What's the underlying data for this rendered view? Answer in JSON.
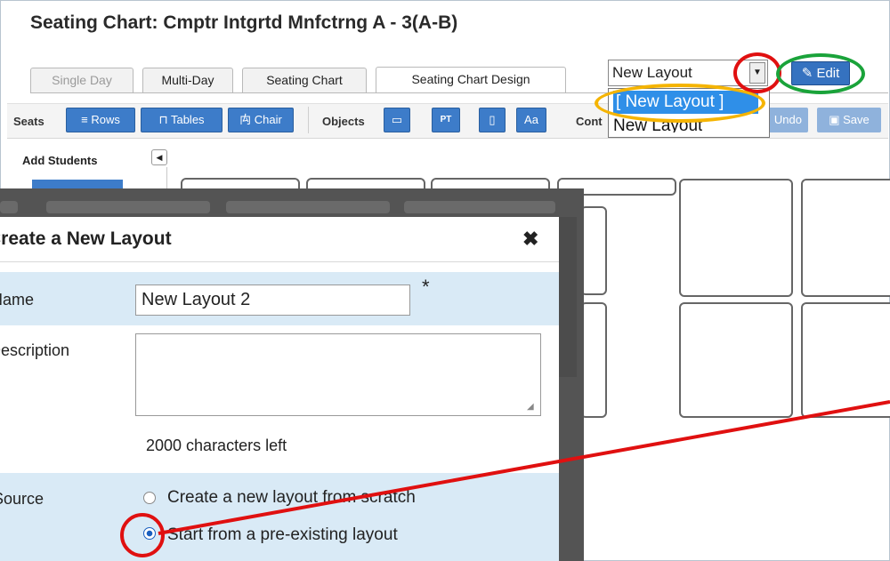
{
  "title": "Seating Chart: Cmptr Intgrtd Mnfctrng A - 3(A-B)",
  "tabs": [
    {
      "label": "Single Day",
      "state": "disabled"
    },
    {
      "label": "Multi-Day",
      "state": "normal"
    },
    {
      "label": "Seating Chart",
      "state": "normal"
    },
    {
      "label": "Seating Chart Design",
      "state": "active"
    }
  ],
  "layout_select": {
    "value": "New Layout",
    "options": [
      "[ New Layout ]",
      "New Layout"
    ]
  },
  "edit_label": "Edit",
  "toolbar": {
    "seats_label": "Seats",
    "rows_label": "Rows",
    "tables_label": "Tables",
    "chair_label": "Chair",
    "objects_label": "Objects",
    "object_icons": [
      "desk-icon",
      "projector-icon",
      "door-icon"
    ],
    "text_label": "Aa",
    "cont_label": "Cont",
    "undo_label": "Undo",
    "save_label": "Save"
  },
  "sidebar": {
    "heading": "Add Students"
  },
  "modal": {
    "title": "Create a New Layout",
    "name_label": "Name",
    "name_value": "New Layout 2",
    "required_mark": "*",
    "description_label": "Description",
    "description_value": "",
    "chars_left": "2000 characters left",
    "source_label": "Source",
    "source_options": [
      {
        "label": "Create a new layout from scratch",
        "selected": false
      },
      {
        "label": "Start from a pre-existing layout",
        "selected": true
      }
    ]
  },
  "colors": {
    "primary_button": "#3d7cc9",
    "selected_option": "#2f8fe8",
    "highlight_red": "#e01010",
    "highlight_orange": "#f5b400",
    "highlight_green": "#1aa33a",
    "form_band": "#d9eaf6"
  }
}
